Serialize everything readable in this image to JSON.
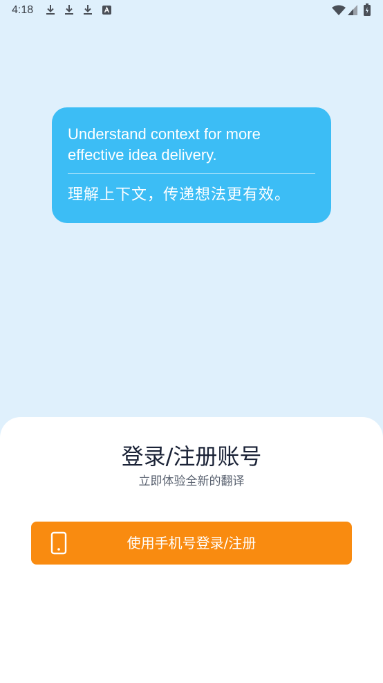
{
  "status_bar": {
    "time": "4:18",
    "left_icons": [
      "download-icon",
      "download-icon",
      "download-icon",
      "keyboard-a-icon"
    ],
    "right_icons": [
      "wifi-icon",
      "signal-icon",
      "battery-icon"
    ]
  },
  "bubble": {
    "english": "Understand context for more effective idea delivery.",
    "chinese": "理解上下文，传递想法更有效。",
    "color": "#3cbdf5"
  },
  "sheet": {
    "title": "登录/注册账号",
    "subtitle": "立即体验全新的翻译",
    "login_button": {
      "label": "使用手机号登录/注册",
      "icon": "phone-icon",
      "color": "#f98b10"
    }
  },
  "colors": {
    "background": "#dff0fc",
    "sheet": "#ffffff"
  }
}
